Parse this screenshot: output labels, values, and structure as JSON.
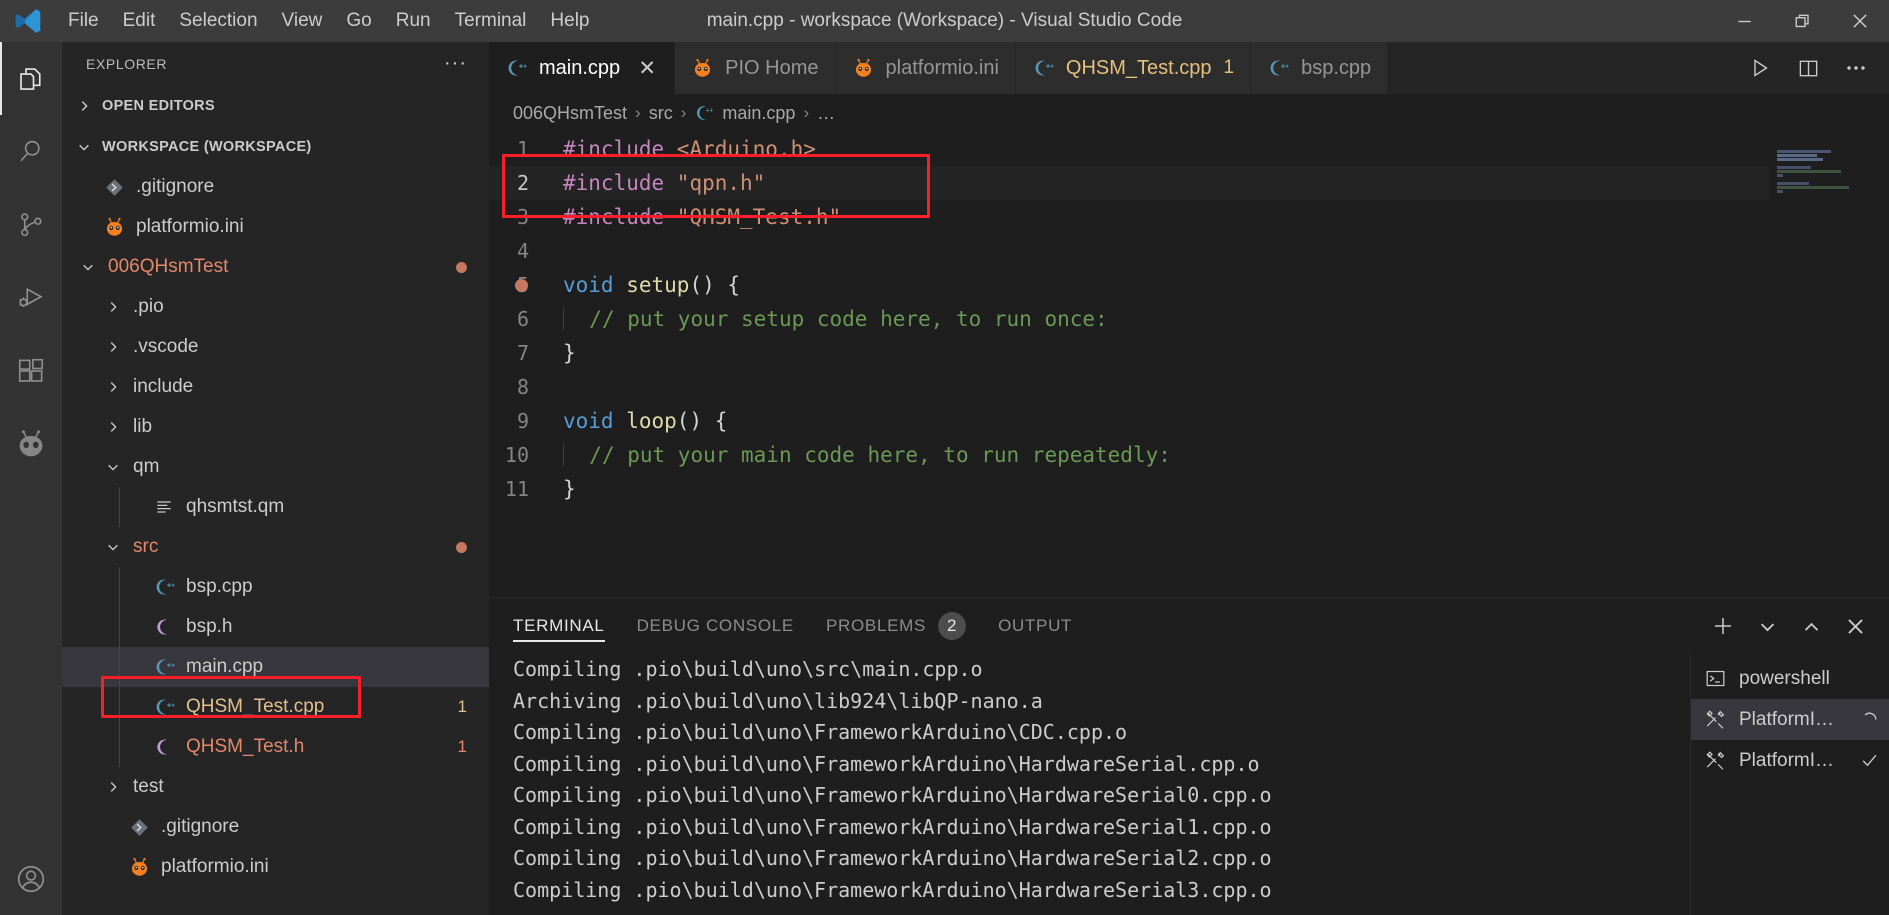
{
  "window": {
    "title": "main.cpp - workspace (Workspace) - Visual Studio Code",
    "minimize_label": "Minimize",
    "restore_label": "Restore",
    "close_label": "Close"
  },
  "menu": {
    "items": [
      {
        "label": "File"
      },
      {
        "label": "Edit"
      },
      {
        "label": "Selection"
      },
      {
        "label": "View"
      },
      {
        "label": "Go"
      },
      {
        "label": "Run"
      },
      {
        "label": "Terminal"
      },
      {
        "label": "Help"
      }
    ]
  },
  "activitybar": {
    "items": [
      {
        "name": "explorer",
        "icon": "files-icon",
        "active": true
      },
      {
        "name": "search",
        "icon": "search-icon",
        "active": false
      },
      {
        "name": "source-control",
        "icon": "source-control-icon",
        "active": false
      },
      {
        "name": "run-debug",
        "icon": "run-debug-icon",
        "active": false
      },
      {
        "name": "extensions",
        "icon": "extensions-icon",
        "active": false
      },
      {
        "name": "platformio",
        "icon": "platformio-alien-icon",
        "active": false
      }
    ],
    "account_icon": "account-icon"
  },
  "sidebar": {
    "title": "EXPLORER",
    "more_actions": "···",
    "sections": [
      {
        "label": "OPEN EDITORS",
        "expanded": false
      },
      {
        "label": "WORKSPACE (WORKSPACE)",
        "expanded": true
      }
    ],
    "tree": [
      {
        "label": ".gitignore",
        "icon": "git-icon",
        "depth": 1,
        "kind": "file",
        "color": "#cccccc"
      },
      {
        "label": "platformio.ini",
        "icon": "pio-icon",
        "depth": 1,
        "kind": "file",
        "color": "#cccccc"
      },
      {
        "label": "006QHsmTest",
        "icon": "none",
        "depth": 1,
        "kind": "folder",
        "expanded": true,
        "color": "#e4886a",
        "dot": true
      },
      {
        "label": ".pio",
        "icon": "none",
        "depth": 2,
        "kind": "folder",
        "expanded": false,
        "color": "#cccccc"
      },
      {
        "label": ".vscode",
        "icon": "none",
        "depth": 2,
        "kind": "folder",
        "expanded": false,
        "color": "#cccccc"
      },
      {
        "label": "include",
        "icon": "none",
        "depth": 2,
        "kind": "folder",
        "expanded": false,
        "color": "#cccccc"
      },
      {
        "label": "lib",
        "icon": "none",
        "depth": 2,
        "kind": "folder",
        "expanded": false,
        "color": "#cccccc"
      },
      {
        "label": "qm",
        "icon": "none",
        "depth": 2,
        "kind": "folder",
        "expanded": true,
        "color": "#cccccc"
      },
      {
        "label": "qhsmtst.qm",
        "icon": "lines-icon",
        "depth": 3,
        "kind": "file",
        "color": "#cccccc"
      },
      {
        "label": "src",
        "icon": "none",
        "depth": 2,
        "kind": "folder",
        "expanded": true,
        "color": "#e4886a",
        "dot": true
      },
      {
        "label": "bsp.cpp",
        "icon": "cpp-icon",
        "depth": 3,
        "kind": "file",
        "color": "#cccccc"
      },
      {
        "label": "bsp.h",
        "icon": "ch-icon",
        "depth": 3,
        "kind": "file",
        "color": "#cccccc"
      },
      {
        "label": "main.cpp",
        "icon": "cpp-icon",
        "depth": 3,
        "kind": "file",
        "color": "#cccccc",
        "selected": true,
        "highlighted": true
      },
      {
        "label": "QHSM_Test.cpp",
        "icon": "cpp-icon",
        "depth": 3,
        "kind": "file",
        "color": "#e2c08d",
        "badge": "1"
      },
      {
        "label": "QHSM_Test.h",
        "icon": "ch-icon",
        "depth": 3,
        "kind": "file",
        "color": "#e4886a",
        "badge": "1"
      },
      {
        "label": "test",
        "icon": "none",
        "depth": 2,
        "kind": "folder",
        "expanded": false,
        "color": "#cccccc"
      },
      {
        "label": ".gitignore",
        "icon": "git-icon",
        "depth": 2,
        "kind": "file",
        "color": "#cccccc"
      },
      {
        "label": "platformio.ini",
        "icon": "pio-icon",
        "depth": 2,
        "kind": "file",
        "color": "#cccccc"
      }
    ]
  },
  "editor": {
    "tabs": [
      {
        "label": "main.cpp",
        "icon": "cpp-icon",
        "active": true,
        "closable": true,
        "error_count": ""
      },
      {
        "label": "PIO Home",
        "icon": "pio-icon",
        "active": false,
        "closable": false,
        "error_count": ""
      },
      {
        "label": "platformio.ini",
        "icon": "pio-icon",
        "active": false,
        "closable": false,
        "error_count": ""
      },
      {
        "label": "QHSM_Test.cpp",
        "icon": "cpp-icon",
        "active": false,
        "closable": false,
        "error_count": "1",
        "error": true
      },
      {
        "label": "bsp.cpp",
        "icon": "cpp-icon",
        "active": false,
        "closable": false,
        "error_count": ""
      }
    ],
    "tab_actions": [
      {
        "name": "run-code-button",
        "icon": "play-icon"
      },
      {
        "name": "split-editor-button",
        "icon": "split-editor-icon"
      },
      {
        "name": "editor-more-button",
        "icon": "ellipsis-icon"
      }
    ],
    "breadcrumb": [
      {
        "label": "006QHsmTest",
        "icon": "none"
      },
      {
        "label": "src",
        "icon": "none"
      },
      {
        "label": "main.cpp",
        "icon": "cpp-icon"
      },
      {
        "label": "…",
        "icon": "none"
      }
    ],
    "breadcrumb_separator": "›",
    "code": [
      {
        "num": "1",
        "tokens": [
          {
            "t": "#include ",
            "c": "pp"
          },
          {
            "t": "<Arduino.h>",
            "c": "inc"
          }
        ]
      },
      {
        "num": "2",
        "tokens": [
          {
            "t": "#include ",
            "c": "pp"
          },
          {
            "t": "\"qpn.h\"",
            "c": "inc"
          }
        ],
        "highlighted": true,
        "current": true
      },
      {
        "num": "3",
        "tokens": [
          {
            "t": "#include ",
            "c": "pp"
          },
          {
            "t": "\"QHSM_Test.h\"",
            "c": "inc"
          }
        ],
        "highlighted": true
      },
      {
        "num": "4",
        "tokens": []
      },
      {
        "num": "5",
        "tokens": [
          {
            "t": "void ",
            "c": "kw"
          },
          {
            "t": "setup",
            "c": "fn"
          },
          {
            "t": "() {",
            "c": "pun"
          }
        ],
        "glyph_dot": true
      },
      {
        "num": "6",
        "tokens": [
          {
            "t": "  ",
            "c": "pun"
          },
          {
            "t": "// put your setup code here, to run once:",
            "c": "com"
          }
        ],
        "indent": true
      },
      {
        "num": "7",
        "tokens": [
          {
            "t": "}",
            "c": "pun"
          }
        ]
      },
      {
        "num": "8",
        "tokens": []
      },
      {
        "num": "9",
        "tokens": [
          {
            "t": "void ",
            "c": "kw"
          },
          {
            "t": "loop",
            "c": "fn"
          },
          {
            "t": "() {",
            "c": "pun"
          }
        ]
      },
      {
        "num": "10",
        "tokens": [
          {
            "t": "  ",
            "c": "pun"
          },
          {
            "t": "// put your main code here, to run repeatedly:",
            "c": "com"
          }
        ],
        "indent": true
      },
      {
        "num": "11",
        "tokens": [
          {
            "t": "}",
            "c": "pun"
          }
        ]
      }
    ]
  },
  "panel": {
    "tabs": [
      {
        "label": "TERMINAL",
        "active": true,
        "badge": ""
      },
      {
        "label": "DEBUG CONSOLE",
        "active": false,
        "badge": ""
      },
      {
        "label": "PROBLEMS",
        "active": false,
        "badge": "2"
      },
      {
        "label": "OUTPUT",
        "active": false,
        "badge": ""
      }
    ],
    "actions": [
      {
        "name": "new-terminal-button",
        "icon": "plus-icon"
      },
      {
        "name": "terminal-dropdown-button",
        "icon": "chevron-down-icon"
      },
      {
        "name": "maximize-panel-button",
        "icon": "chevron-up-icon"
      },
      {
        "name": "close-panel-button",
        "icon": "close-icon"
      }
    ],
    "terminal_lines": [
      "Compiling .pio\\build\\uno\\src\\main.cpp.o",
      "Archiving .pio\\build\\uno\\lib924\\libQP-nano.a",
      "Compiling .pio\\build\\uno\\FrameworkArduino\\CDC.cpp.o",
      "Compiling .pio\\build\\uno\\FrameworkArduino\\HardwareSerial.cpp.o",
      "Compiling .pio\\build\\uno\\FrameworkArduino\\HardwareSerial0.cpp.o",
      "Compiling .pio\\build\\uno\\FrameworkArduino\\HardwareSerial1.cpp.o",
      "Compiling .pio\\build\\uno\\FrameworkArduino\\HardwareSerial2.cpp.o",
      "Compiling .pio\\build\\uno\\FrameworkArduino\\HardwareSerial3.cpp.o"
    ],
    "terminal_instances": [
      {
        "label": "powershell",
        "icon": "terminal-icon",
        "selected": false,
        "status": ""
      },
      {
        "label": "PlatformI…",
        "icon": "tools-icon",
        "selected": true,
        "status": "spinner"
      },
      {
        "label": "PlatformI…",
        "icon": "tools-icon",
        "selected": false,
        "status": "check"
      }
    ]
  },
  "colors": {
    "accent": "#007acc",
    "highlight_box": "#fa1e28",
    "modified": "#e4886a",
    "warning": "#e2c08d",
    "cpp_icon": "#519aba",
    "pio_orange": "#f4801f"
  }
}
